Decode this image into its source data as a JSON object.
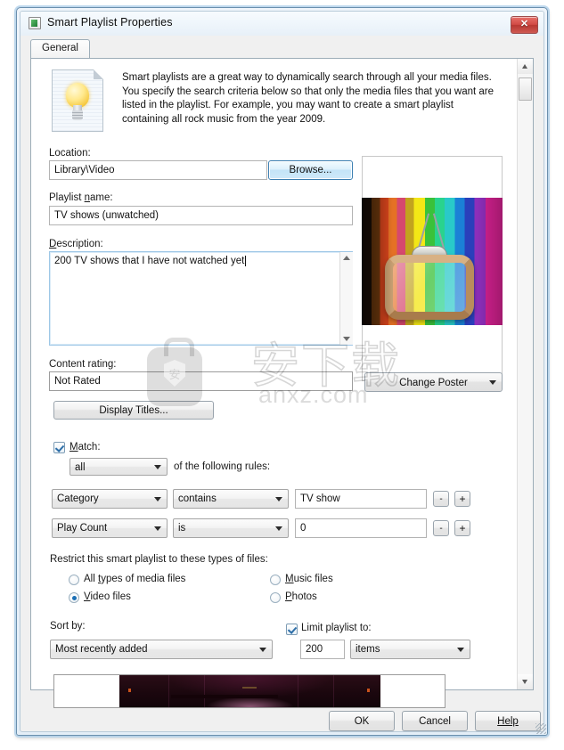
{
  "window": {
    "title": "Smart Playlist Properties",
    "icon": "app-icon",
    "close_label": "✕"
  },
  "tabs": [
    {
      "label": "General",
      "active": true
    }
  ],
  "intro": {
    "icon": "lightbulb-document-icon",
    "text": "Smart playlists are a great way to dynamically search through all your media files.  You specify the search criteria below so that only the media files that you want are listed in the playlist.  For example, you may want to create a smart playlist containing all rock music from the year 2009."
  },
  "location": {
    "label": "Location:",
    "value": "Library\\Video",
    "browse_label": "Browse..."
  },
  "playlist_name": {
    "label": "Playlist name:",
    "value": "TV shows (unwatched)"
  },
  "description": {
    "label": "Description:",
    "value": "200 TV shows that I have not watched yet"
  },
  "content_rating": {
    "label": "Content rating:",
    "value": "Not Rated"
  },
  "display_titles": {
    "label": "Display Titles..."
  },
  "poster": {
    "change_label": "Change Poster",
    "alt": "retro-television-rainbow-stripes"
  },
  "match": {
    "label": "Match:",
    "checked": true,
    "operator": "all",
    "suffix": "of the following rules:",
    "rules": [
      {
        "field": "Category",
        "comparator": "contains",
        "value": "TV show",
        "remove": "-",
        "add": "+"
      },
      {
        "field": "Play Count",
        "comparator": "is",
        "value": "0",
        "remove": "-",
        "add": "+"
      }
    ]
  },
  "restrict": {
    "label": "Restrict this smart playlist to these types of files:",
    "options": [
      {
        "label": "All types of media files",
        "selected": false
      },
      {
        "label": "Music files",
        "selected": false
      },
      {
        "label": "Video files",
        "selected": true
      },
      {
        "label": "Photos",
        "selected": false
      }
    ]
  },
  "sort_by": {
    "label": "Sort by:",
    "value": "Most recently added"
  },
  "limit": {
    "label": "Limit playlist to:",
    "checked": true,
    "amount": "200",
    "unit": "items"
  },
  "footer": {
    "ok": "OK",
    "cancel": "Cancel",
    "help": "Help"
  },
  "watermark": {
    "cn": "安下载",
    "domain": "anxz.com",
    "badge_char": "安"
  },
  "colors": {
    "accent": "#3c7fb1",
    "close": "#d14a45",
    "radio_dot": "#1b6fb5",
    "check": "#2d6ea8"
  }
}
